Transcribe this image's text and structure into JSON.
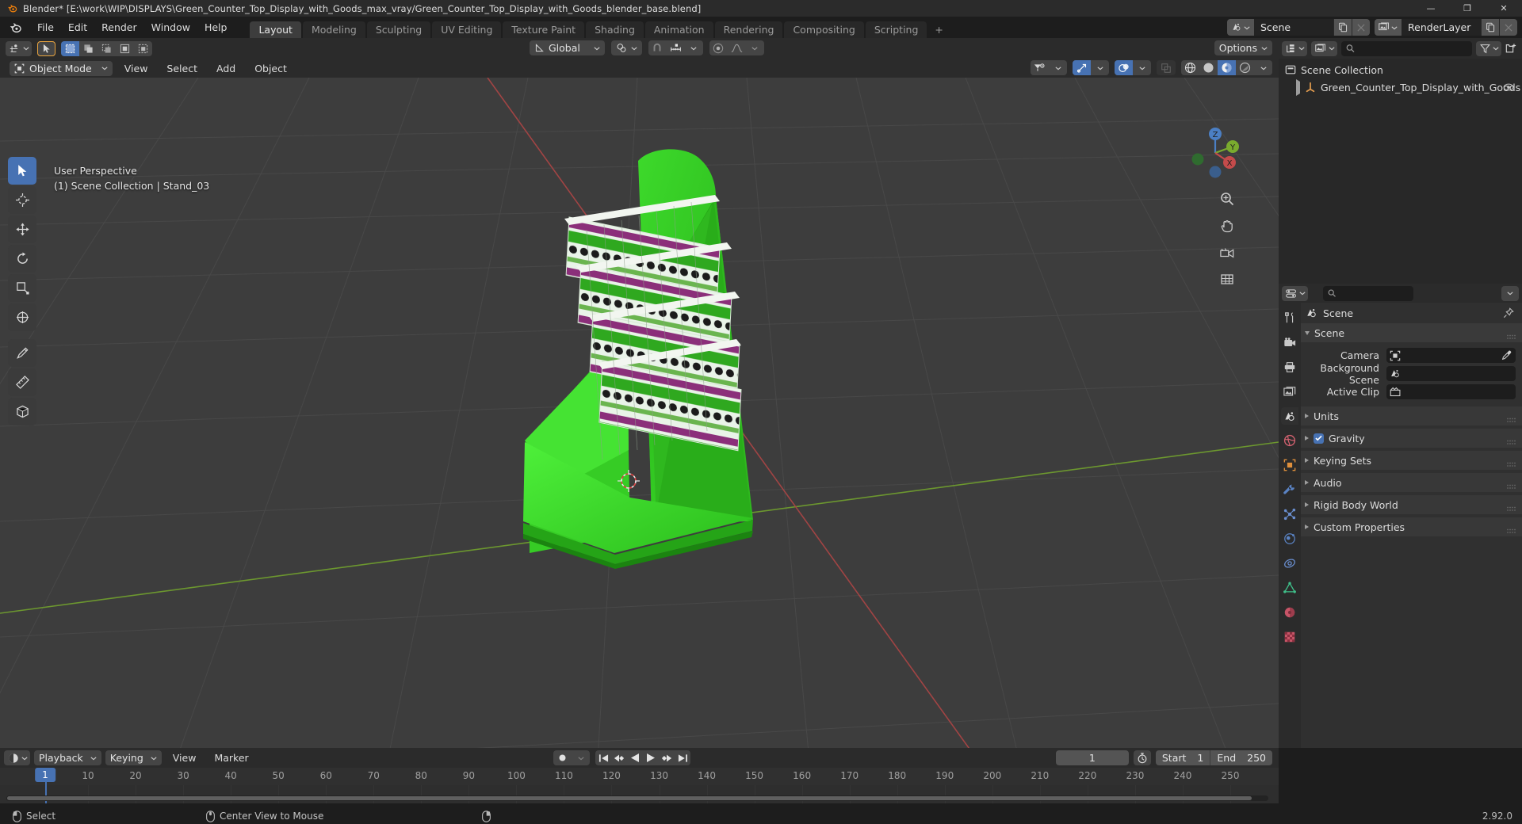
{
  "window": {
    "title": "Blender* [E:\\work\\WIP\\DISPLAYS\\Green_Counter_Top_Display_with_Goods_max_vray/Green_Counter_Top_Display_with_Goods_blender_base.blend]",
    "minimize": "—",
    "maximize": "❐",
    "close": "✕"
  },
  "topbar": {
    "menus": [
      "File",
      "Edit",
      "Render",
      "Window",
      "Help"
    ],
    "workspaces": [
      "Layout",
      "Modeling",
      "Sculpting",
      "UV Editing",
      "Texture Paint",
      "Shading",
      "Animation",
      "Rendering",
      "Compositing",
      "Scripting"
    ],
    "active_workspace": "Layout",
    "add_workspace": "+",
    "scene_name": "Scene",
    "view_layer_name": "RenderLayer"
  },
  "viewport": {
    "mode": "Object Mode",
    "menus": [
      "View",
      "Select",
      "Add",
      "Object"
    ],
    "transform_orientation": "Global",
    "options_label": "Options",
    "overlay_line1": "User Perspective",
    "overlay_line2": "(1) Scene Collection | Stand_03",
    "gizmo_axes": {
      "x": "X",
      "y": "Y",
      "z": "Z"
    },
    "tools": [
      "tweak-tool",
      "cursor-tool",
      "move-tool",
      "rotate-tool",
      "scale-tool",
      "transform-tool",
      "annotate-tool",
      "measure-tool",
      "add-cube-tool"
    ]
  },
  "outliner": {
    "search_placeholder": "",
    "rows": [
      {
        "label": "Scene Collection",
        "icon": "collection-icon",
        "indent": 0
      },
      {
        "label": "Green_Counter_Top_Display_with_Goods",
        "icon": "object-icon",
        "indent": 1
      }
    ]
  },
  "properties": {
    "search_placeholder": "",
    "breadcrumb": "Scene",
    "panels": [
      {
        "label": "Scene",
        "open": true
      },
      {
        "label": "Units",
        "open": false
      },
      {
        "label": "Gravity",
        "open": false,
        "checkbox": true
      },
      {
        "label": "Keying Sets",
        "open": false
      },
      {
        "label": "Audio",
        "open": false
      },
      {
        "label": "Rigid Body World",
        "open": false
      },
      {
        "label": "Custom Properties",
        "open": false
      }
    ],
    "fields": [
      {
        "label": "Camera",
        "value": "",
        "icon": "camera-icon"
      },
      {
        "label": "Background Scene",
        "value": "",
        "icon": "scene-icon"
      },
      {
        "label": "Active Clip",
        "value": "",
        "icon": "clip-icon"
      }
    ],
    "tabs": [
      "tool-tab",
      "render-tab",
      "output-tab",
      "view-layer-tab",
      "scene-tab",
      "world-tab",
      "object-tab",
      "modifier-tab",
      "particles-tab",
      "physics-tab",
      "constraints-tab",
      "data-tab",
      "material-tab",
      "texture-tab"
    ]
  },
  "timeline": {
    "menus": [
      "Playback",
      "Keying",
      "View",
      "Marker"
    ],
    "current_frame": "1",
    "start_label": "Start",
    "start_value": "1",
    "end_label": "End",
    "end_value": "250",
    "ticks": [
      1,
      10,
      20,
      30,
      40,
      50,
      60,
      70,
      80,
      90,
      100,
      110,
      120,
      130,
      140,
      150,
      160,
      170,
      180,
      190,
      200,
      210,
      220,
      230,
      240,
      250
    ]
  },
  "statusbar": {
    "items": [
      {
        "icon": "mouse-left-icon",
        "label": "Select"
      },
      {
        "icon": "mouse-middle-icon",
        "label": "Center View to Mouse"
      },
      {
        "icon": "mouse-right-icon",
        "label": ""
      }
    ],
    "version": "2.92.0"
  },
  "colors": {
    "accent": "#4772b3",
    "tool_active": "#e8a33d",
    "model_green": "#2dc21e",
    "x_axis": "#b24a4a",
    "y_axis": "#7aab2e"
  }
}
